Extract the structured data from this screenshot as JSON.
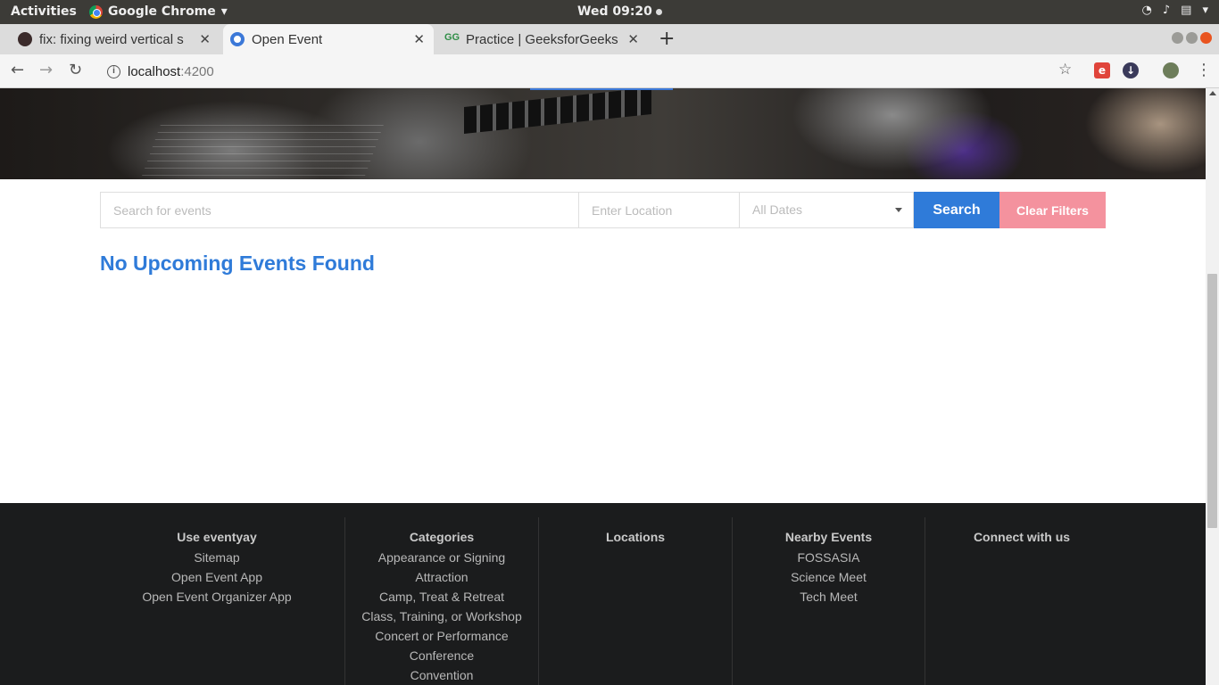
{
  "os_bar": {
    "activities": "Activities",
    "app_name": "Google Chrome",
    "clock": "Wed 09:20"
  },
  "browser": {
    "tabs": [
      {
        "title": "fix: fixing weird vertical s",
        "close": "✕"
      },
      {
        "title": "Open Event",
        "close": "✕"
      },
      {
        "title": "Practice | GeeksforGeeks |",
        "close": "✕"
      }
    ],
    "new_tab": "+",
    "url_host": "localhost",
    "url_port": ":4200"
  },
  "search": {
    "events_placeholder": "Search for events",
    "location_placeholder": "Enter Location",
    "dates_value": "All Dates",
    "search_label": "Search",
    "clear_label": "Clear Filters"
  },
  "main": {
    "no_events": "No Upcoming Events Found"
  },
  "footer": {
    "use": {
      "heading": "Use eventyay",
      "links": [
        "Sitemap",
        "Open Event App",
        "Open Event Organizer App"
      ]
    },
    "categories": {
      "heading": "Categories",
      "links": [
        "Appearance or Signing",
        "Attraction",
        "Camp, Treat & Retreat",
        "Class, Training, or Workshop",
        "Concert or Performance",
        "Conference",
        "Convention"
      ]
    },
    "locations": {
      "heading": "Locations"
    },
    "nearby": {
      "heading": "Nearby Events",
      "links": [
        "FOSSASIA",
        "Science Meet",
        "Tech Meet"
      ]
    },
    "connect": {
      "heading": "Connect with us"
    }
  },
  "colors": {
    "primary": "#2f7bd9",
    "clear_button": "#f4929e",
    "footer_bg": "#1b1c1d"
  }
}
